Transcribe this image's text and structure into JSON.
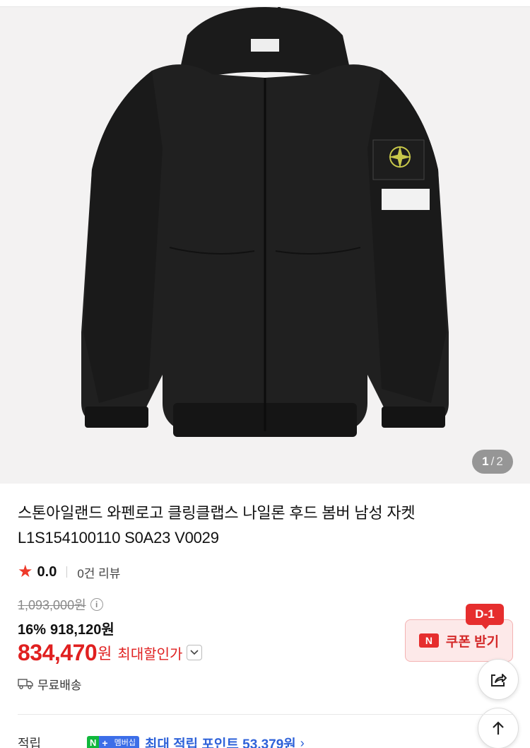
{
  "gallery": {
    "current": "1",
    "separator": "/",
    "total": "2"
  },
  "product": {
    "title_line1": "스톤아일랜드 와펜로고 클링클랩스 나일론 후드 봄버 남성 자켓",
    "title_line2": "L1S154100110 S0A23 V0029"
  },
  "rating": {
    "score": "0.0",
    "reviews": "0건 리뷰"
  },
  "price": {
    "original": "1,093,000원",
    "discount_percent": "16%",
    "sale": "918,120원",
    "final_amount": "834,470",
    "final_unit": "원",
    "max_discount_label": "최대할인가"
  },
  "shipping": {
    "label": "무료배송"
  },
  "coupon": {
    "badge": "D-1",
    "logo": "N",
    "label": "쿠폰 받기"
  },
  "points": {
    "label": "적립",
    "badge_n": "N",
    "badge_plus": "+",
    "badge_membership": "멤버십",
    "text": "최대 적립 포인트 53,379원"
  },
  "icons": [
    "info-icon",
    "chevron-down-icon",
    "truck-icon",
    "share-icon",
    "arrow-up-icon",
    "star-icon"
  ],
  "colors": {
    "accent_red": "#e02020",
    "point_blue": "#2e62d9",
    "star": "#ee3a2b"
  }
}
